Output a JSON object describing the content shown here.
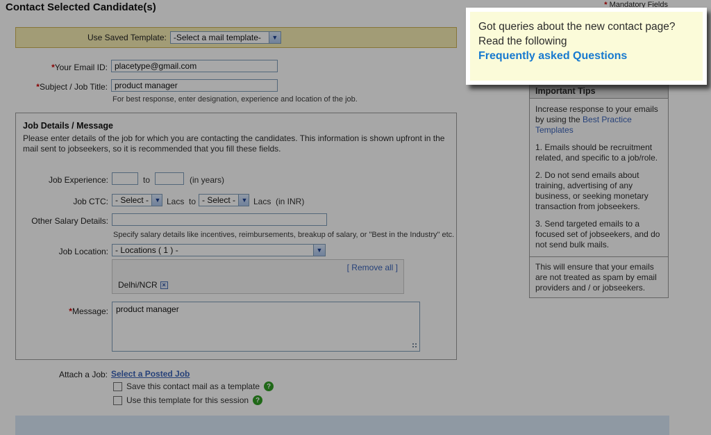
{
  "page": {
    "title": "Contact Selected Candidate(s)",
    "asterisk": "*",
    "mandatory_note": "Mandatory Fields"
  },
  "icons": {
    "dropdown_arrow": "▼",
    "close_x": "×",
    "help": "?"
  },
  "template_bar": {
    "label": "Use Saved Template:",
    "selected": "-Select a mail template-"
  },
  "fields": {
    "email": {
      "label": "Your Email ID:",
      "value": "placetype@gmail.com"
    },
    "subject": {
      "label": "Subject / Job Title:",
      "value": "product manager",
      "hint": "For best response, enter designation, experience and location of the job."
    }
  },
  "job_details": {
    "heading": "Job Details / Message",
    "description": "Please enter details of the job for which you are contacting the candidates. This information is shown upfront in the mail sent to jobseekers, so it is recommended that you fill these fields.",
    "experience": {
      "label": "Job Experience:",
      "min": "",
      "max": "",
      "mid": "to",
      "suffix": "(in years)"
    },
    "ctc": {
      "label": "Job CTC:",
      "selected1": "- Select -",
      "mid": "Lacs  to",
      "selected2": "- Select -",
      "suffix": "Lacs  (in INR)"
    },
    "other_salary": {
      "label": "Other Salary Details:",
      "value": "",
      "hint": "Specify salary details like incentives, reimbursements, breakup of salary, or \"Best in the Industry\" etc."
    },
    "location": {
      "label": "Job Location:",
      "selected": "- Locations ( 1 ) -",
      "remove_all": "[ Remove all ]",
      "chips": [
        {
          "label": "Delhi/NCR"
        }
      ]
    },
    "message": {
      "label": "Message:",
      "value": "product manager"
    }
  },
  "attach": {
    "label": "Attach a Job:",
    "link": "Select a Posted Job"
  },
  "checkboxes": [
    {
      "label": "Save this contact mail as a template"
    },
    {
      "label": "Use this template for this session"
    }
  ],
  "callout": {
    "text": "Got queries about the new contact page? Read the following",
    "link": "Frequently asked Questions"
  },
  "sidebar": {
    "header": "Important Tips",
    "intro_prefix": "Increase response to your emails by using the ",
    "intro_link": "Best Practice Templates",
    "tips": [
      "1. Emails should be recruitment related, and specific to a job/role.",
      "2. Do not send emails about training, advertising of any business, or seeking monetary transaction from jobseekers.",
      "3. Send targeted emails to a focused set of jobseekers, and do not send bulk mails."
    ],
    "footer_note": "This will ensure that your emails are not treated as spam by email providers and / or jobseekers."
  },
  "colors": {
    "highlight_bar_bg": "#f6edb4",
    "callout_bg": "#fbfbd9",
    "faq_link_blue": "#1779cf",
    "link_blue": "#3a63b8",
    "required_red": "#cc0000",
    "help_green": "#2f9e23",
    "bottom_bar_blue": "#d9e9f7"
  }
}
